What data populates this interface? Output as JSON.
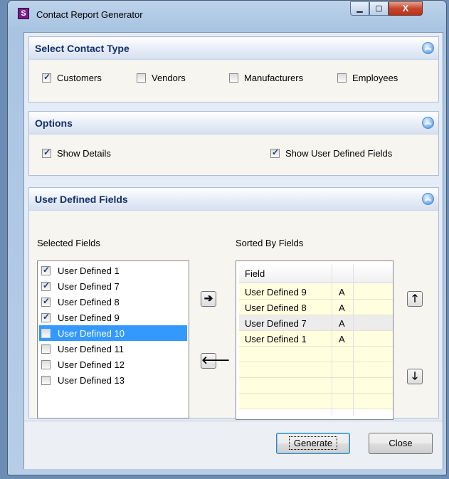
{
  "window": {
    "title": "Contact Report Generator",
    "icon_glyph": "S",
    "controls": {
      "minimize": "▁",
      "maximize": "▢",
      "close": "X"
    }
  },
  "contact_type": {
    "title": "Select Contact Type",
    "options": [
      {
        "label": "Customers",
        "checked": true
      },
      {
        "label": "Vendors",
        "checked": false
      },
      {
        "label": "Manufacturers",
        "checked": false
      },
      {
        "label": "Employees",
        "checked": false
      }
    ]
  },
  "options_panel": {
    "title": "Options",
    "show_details": {
      "label": "Show Details",
      "checked": true
    },
    "show_udf": {
      "label": "Show User Defined Fields",
      "checked": true
    }
  },
  "udf_panel": {
    "title": "User Defined Fields",
    "selected_label": "Selected Fields",
    "sorted_label": "Sorted By Fields",
    "fields": [
      {
        "label": "User Defined 1",
        "checked": true,
        "selected": false
      },
      {
        "label": "User Defined 7",
        "checked": true,
        "selected": false
      },
      {
        "label": "User Defined 8",
        "checked": true,
        "selected": false
      },
      {
        "label": "User Defined 9",
        "checked": true,
        "selected": false
      },
      {
        "label": "User Defined 10",
        "checked": false,
        "selected": true
      },
      {
        "label": "User Defined 11",
        "checked": false,
        "selected": false
      },
      {
        "label": "User Defined 12",
        "checked": false,
        "selected": false
      },
      {
        "label": "User Defined 13",
        "checked": false,
        "selected": false
      }
    ],
    "grid_header": {
      "field": "Field",
      "order": ""
    },
    "sorted": [
      {
        "field": "User Defined 9",
        "order": "A"
      },
      {
        "field": "User Defined 8",
        "order": "A"
      },
      {
        "field": "User Defined 7",
        "order": "A"
      },
      {
        "field": "User Defined 1",
        "order": "A"
      }
    ],
    "arrows": {
      "add": "➔",
      "remove": "🡐",
      "up": "🡑",
      "down": "🡓"
    }
  },
  "footer": {
    "generate": "Generate",
    "close": "Close"
  },
  "icons": {
    "collapse": "chevron-up-double",
    "app": "app-s-icon"
  }
}
